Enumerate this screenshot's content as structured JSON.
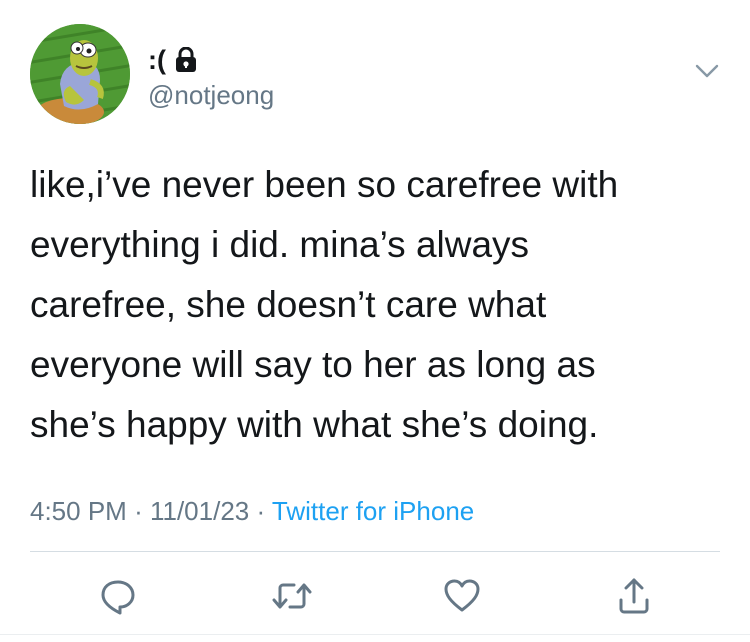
{
  "tweet": {
    "display_name": ":(",
    "handle": "@notjeong",
    "text_lines": [
      "like,i’ve never been so carefree with",
      "everything i did. mina’s always",
      "carefree, she doesn’t care what",
      "everyone will say to her as long as",
      "she’s happy with what she’s doing."
    ],
    "time": "4:50 PM",
    "date": "11/01/23",
    "separator": "·",
    "source": "Twitter for iPhone"
  },
  "icons": {
    "lock": "lock-icon",
    "more": "chevron-down-icon",
    "reply": "reply-icon",
    "retweet": "retweet-icon",
    "like": "heart-icon",
    "share": "share-icon"
  },
  "colors": {
    "text": "#14171a",
    "muted": "#657786",
    "link": "#1da1f2",
    "divider": "#d5dde3"
  }
}
